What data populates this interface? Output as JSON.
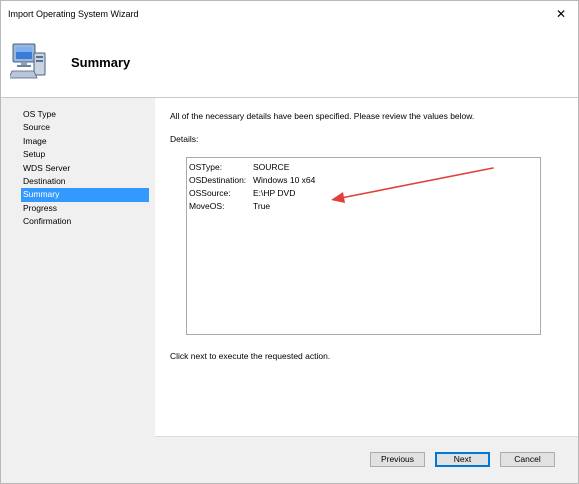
{
  "window": {
    "title": "Import Operating System Wizard",
    "close_glyph": "✕"
  },
  "header": {
    "title": "Summary",
    "icon": "computer-icon"
  },
  "nav": {
    "items": [
      {
        "label": "OS Type"
      },
      {
        "label": "Source"
      },
      {
        "label": "Image"
      },
      {
        "label": "Setup"
      },
      {
        "label": "WDS Server"
      },
      {
        "label": "Destination"
      },
      {
        "label": "Summary",
        "active": true
      },
      {
        "label": "Progress"
      },
      {
        "label": "Confirmation"
      }
    ]
  },
  "content": {
    "intro": "All of the necessary details have been specified.  Please review the values below.",
    "details_label": "Details:",
    "details": [
      {
        "key": "OSType:",
        "value": "SOURCE"
      },
      {
        "key": "OSDestination:",
        "value": "Windows 10 x64"
      },
      {
        "key": "OSSource:",
        "value": "E:\\HP DVD"
      },
      {
        "key": "MoveOS:",
        "value": "True"
      }
    ],
    "outro": "Click next to execute the requested action."
  },
  "buttons": {
    "previous": "Previous",
    "next": "Next",
    "cancel": "Cancel"
  },
  "colors": {
    "selection": "#3399ff",
    "annotation_arrow": "#e0403a",
    "default_button_border": "#0078d7"
  }
}
